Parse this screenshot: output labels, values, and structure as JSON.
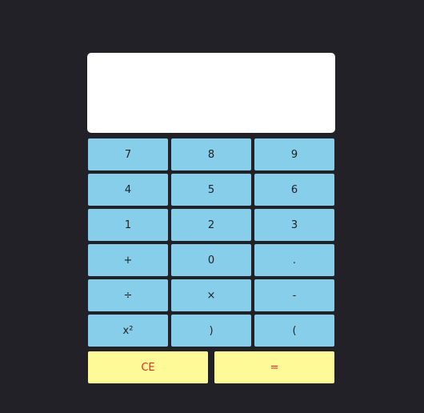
{
  "display": {
    "value": ""
  },
  "keys": [
    {
      "label": "7",
      "name": "key-7"
    },
    {
      "label": "8",
      "name": "key-8"
    },
    {
      "label": "9",
      "name": "key-9"
    },
    {
      "label": "4",
      "name": "key-4"
    },
    {
      "label": "5",
      "name": "key-5"
    },
    {
      "label": "6",
      "name": "key-6"
    },
    {
      "label": "1",
      "name": "key-1"
    },
    {
      "label": "2",
      "name": "key-2"
    },
    {
      "label": "3",
      "name": "key-3"
    },
    {
      "label": "+",
      "name": "key-plus"
    },
    {
      "label": "0",
      "name": "key-0"
    },
    {
      "label": ".",
      "name": "key-decimal"
    },
    {
      "label": "÷",
      "name": "key-divide"
    },
    {
      "label": "×",
      "name": "key-multiply"
    },
    {
      "label": "-",
      "name": "key-minus"
    },
    {
      "label": "x²",
      "name": "key-square"
    },
    {
      "label": ")",
      "name": "key-close-paren"
    },
    {
      "label": "(",
      "name": "key-open-paren"
    }
  ],
  "actions": {
    "clear_label": "CE",
    "equals_label": "="
  },
  "colors": {
    "background": "#222127",
    "display": "#ffffff",
    "key": "#87ceeb",
    "action_key": "#fffa98",
    "action_text": "#e02a2a"
  }
}
